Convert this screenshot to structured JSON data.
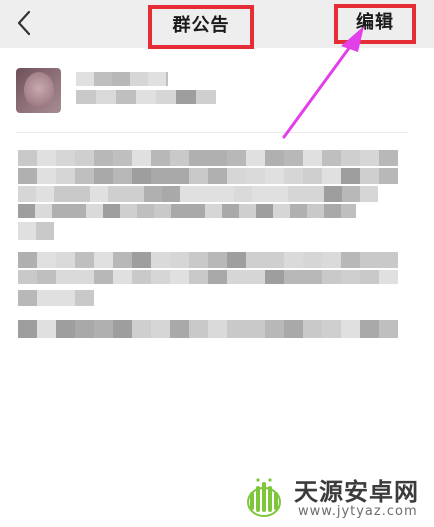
{
  "navbar": {
    "back_icon": "chevron-left-icon",
    "title": "群公告",
    "edit_label": "编辑"
  },
  "annotation": {
    "highlight_color": "#e62d35",
    "arrow_color": "#e23fe8"
  },
  "poster": {
    "avatar_icon": "avatar"
  },
  "watermark": {
    "title": "天源安卓网",
    "url": "www.jytyaz.com",
    "logo_color": "#7ec63a"
  }
}
